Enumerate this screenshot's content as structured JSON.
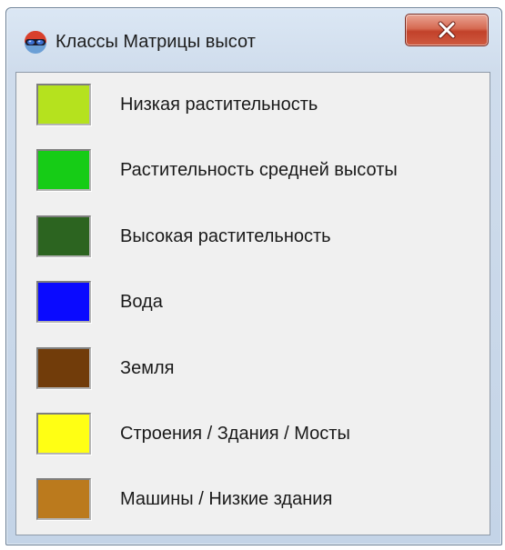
{
  "window": {
    "title": "Классы Матрицы высот",
    "app_icon": "3d-glasses-icon",
    "close_icon": "close-icon"
  },
  "classes": [
    {
      "label": "Низкая растительность",
      "color": "#b5e21e"
    },
    {
      "label": "Растительность средней высоты",
      "color": "#16cc16"
    },
    {
      "label": "Высокая растительность",
      "color": "#2c6420"
    },
    {
      "label": "Вода",
      "color": "#0a0aff"
    },
    {
      "label": "Земля",
      "color": "#713c0a"
    },
    {
      "label": "Строения / Здания / Мосты",
      "color": "#ffff14"
    },
    {
      "label": "Машины / Низкие здания",
      "color": "#bb7a1d"
    }
  ]
}
